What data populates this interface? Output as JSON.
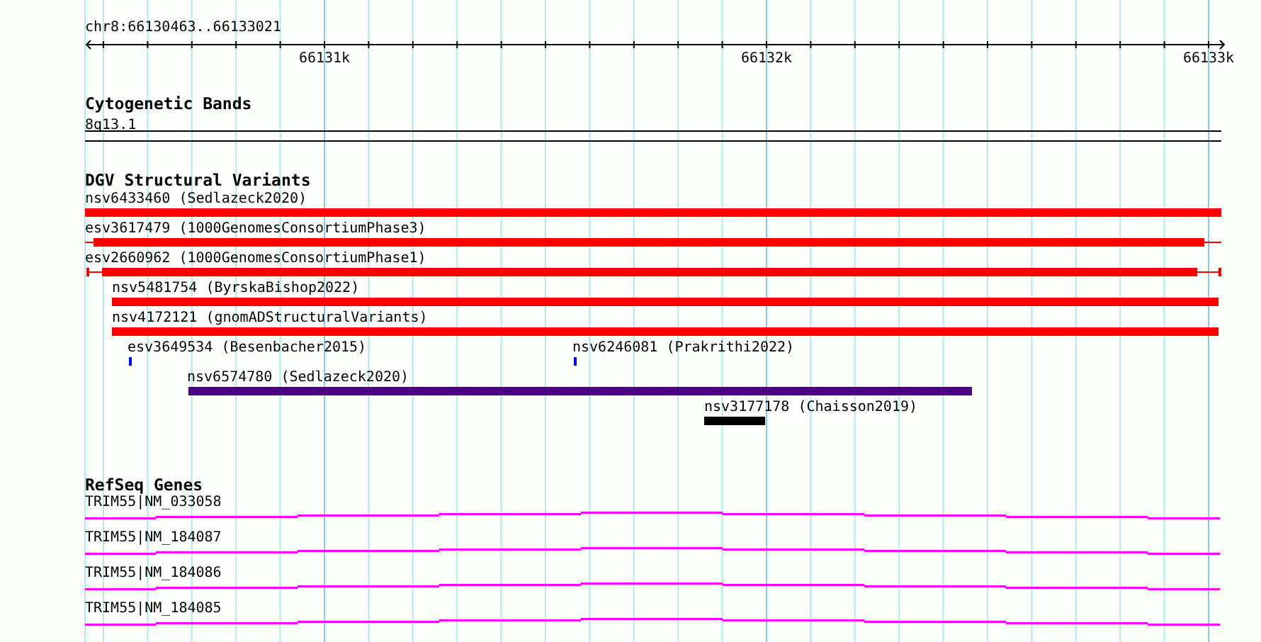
{
  "ruler": {
    "region": "chr8:66130463..66133021",
    "ticks": [
      "66131k",
      "66132k",
      "66133k"
    ]
  },
  "tracks": [
    {
      "title": "Cytogenetic Bands",
      "kind": "bands",
      "features": [
        {
          "label": "8q13.1"
        }
      ]
    },
    {
      "title": "DGV Structural Variants",
      "kind": "variants",
      "features": [
        {
          "label": "nsv6433460 (Sedlazeck2020)",
          "color": "#ff0000"
        },
        {
          "label": "esv3617479 (1000GenomesConsortiumPhase3)",
          "color": "#ff0000"
        },
        {
          "label": "esv2660962 (1000GenomesConsortiumPhase1)",
          "color": "#ff0000"
        },
        {
          "label": "nsv5481754 (ByrskaBishop2022)",
          "color": "#ff0000"
        },
        {
          "label": "nsv4172121 (gnomADStructuralVariants)",
          "color": "#ff0000"
        },
        {
          "label": "esv3649534 (Besenbacher2015)",
          "color": "#0000ff"
        },
        {
          "label": "nsv6246081 (Prakrithi2022)",
          "color": "#0000ff"
        },
        {
          "label": "nsv6574780 (Sedlazeck2020)",
          "color": "#4b0082"
        },
        {
          "label": "nsv3177178 (Chaisson2019)",
          "color": "#000000"
        }
      ]
    },
    {
      "title": "RefSeq Genes",
      "kind": "genes",
      "features": [
        {
          "label": "TRIM55|NM_033058"
        },
        {
          "label": "TRIM55|NM_184087"
        },
        {
          "label": "TRIM55|NM_184086"
        },
        {
          "label": "TRIM55|NM_184085"
        }
      ]
    }
  ]
}
